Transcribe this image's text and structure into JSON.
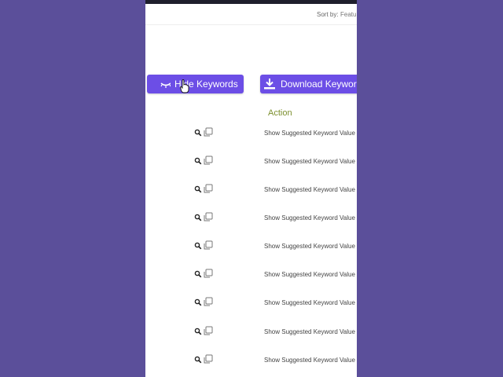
{
  "sort": {
    "label": "Sort by:",
    "value": "Featur"
  },
  "buttons": {
    "hide_keywords": "Hide Keywords",
    "download_keywords": "Download Keywords"
  },
  "table": {
    "action_header": "Action",
    "rows": [
      {
        "action": "Show Suggested Keyword Value"
      },
      {
        "action": "Show Suggested Keyword Value"
      },
      {
        "action": "Show Suggested Keyword Value"
      },
      {
        "action": "Show Suggested Keyword Value"
      },
      {
        "action": "Show Suggested Keyword Value"
      },
      {
        "action": "Show Suggested Keyword Value"
      },
      {
        "action": "Show Suggested Keyword Value"
      },
      {
        "action": "Show Suggested Keyword Value"
      },
      {
        "action": "Show Suggested Keyword Value"
      }
    ]
  },
  "icons": {
    "hide": "eye-closed-icon",
    "download": "download-icon",
    "row_search": "search-icon",
    "row_copy": "copy-icon",
    "pointer": "hand-cursor-icon"
  },
  "colors": {
    "background": "#5b4f9a",
    "button": "#6c4ee6",
    "action_header": "#7c8f2e",
    "top_bar": "#1e1e2c"
  }
}
